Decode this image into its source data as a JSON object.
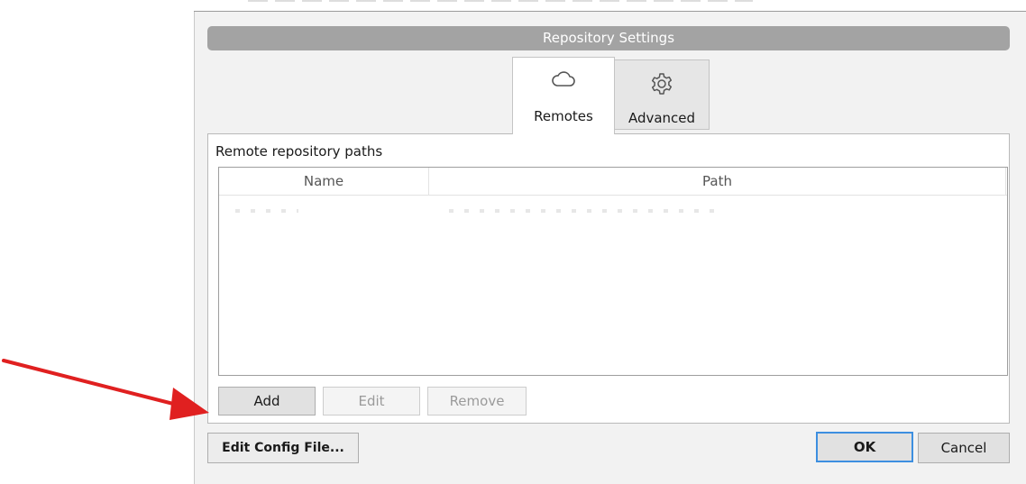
{
  "dialog": {
    "title": "Repository Settings"
  },
  "tabs": [
    {
      "label": "Remotes",
      "icon": "cloud-icon",
      "active": true
    },
    {
      "label": "Advanced",
      "icon": "gear-icon",
      "active": false
    }
  ],
  "remotes": {
    "section_label": "Remote repository paths",
    "columns": [
      "Name",
      "Path"
    ],
    "buttons": {
      "add": "Add",
      "edit": "Edit",
      "remove": "Remove"
    }
  },
  "footer": {
    "edit_config": "Edit Config File...",
    "ok": "OK",
    "cancel": "Cancel"
  },
  "annotation": {
    "arrow_color": "#e02020"
  },
  "colors": {
    "title_bar": "#a3a3a3",
    "ok_focus_border": "#3d8fe0"
  }
}
